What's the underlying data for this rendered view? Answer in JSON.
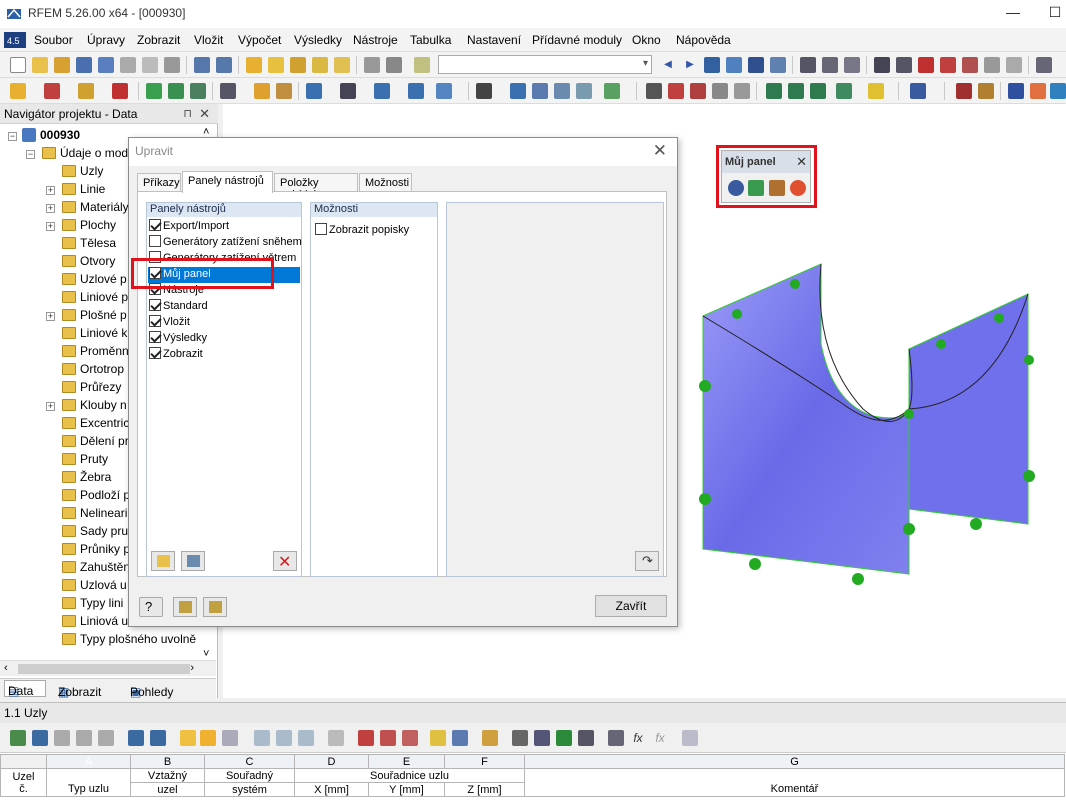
{
  "app": {
    "title": "RFEM 5.26.00 x64 - [000930]"
  },
  "menu": [
    "Soubor",
    "Úpravy",
    "Zobrazit",
    "Vložit",
    "Výpočet",
    "Výsledky",
    "Nástroje",
    "Tabulka",
    "Nastavení",
    "Přídavné moduly",
    "Okno",
    "Nápověda"
  ],
  "navigator": {
    "title": "Navigátor projektu - Data",
    "root": "000930",
    "group": "Údaje o mod",
    "items": [
      "Uzly",
      "Linie",
      "Materiály",
      "Plochy",
      "Tělesa",
      "Otvory",
      "Uzlové p",
      "Liniové p",
      "Plošné p",
      "Liniové k",
      "Proměnn",
      "Ortotrop",
      "Průřezy",
      "Klouby n",
      "Excentric",
      "Dělení pr",
      "Pruty",
      "Žebra",
      "Podloží p",
      "Nelineari",
      "Sady pru",
      "Průniky p",
      "Zahuštěn",
      "Uzlová u",
      "Typy lini",
      "Liniová u",
      "Typy plošného uvolně"
    ],
    "tabs": [
      "Data",
      "Zobrazit",
      "Pohledy"
    ]
  },
  "dialog": {
    "title": "Upravit",
    "tabs": [
      "Příkazy",
      "Panely nástrojů",
      "Položky nabídek",
      "Možnosti"
    ],
    "active_tab": "Panely nástrojů",
    "toolbars_header": "Panely nástrojů",
    "toolbars": [
      {
        "label": "Export/Import",
        "checked": true
      },
      {
        "label": "Generátory zatížení sněhem",
        "checked": false
      },
      {
        "label": "Generátory zatížení větrem",
        "checked": false
      },
      {
        "label": "Můj panel",
        "checked": true,
        "selected": true
      },
      {
        "label": "Nástroje",
        "checked": true
      },
      {
        "label": "Standard",
        "checked": true
      },
      {
        "label": "Vložit",
        "checked": true
      },
      {
        "label": "Výsledky",
        "checked": true
      },
      {
        "label": "Zobrazit",
        "checked": true
      }
    ],
    "options_header": "Možnosti",
    "show_labels": "Zobrazit popisky",
    "close_label": "Zavřít"
  },
  "floating_panel": {
    "title": "Můj panel"
  },
  "table": {
    "title": "1.1 Uzly",
    "letters": [
      "A",
      "B",
      "C",
      "D",
      "E",
      "F",
      "G"
    ],
    "uzel": "Uzel",
    "uzel_c": "č.",
    "typ_uzlu": "Typ uzlu",
    "vztazny_1": "Vztažný",
    "vztazny_2": "uzel",
    "sour_sys_1": "Souřadný",
    "sour_sys_2": "systém",
    "coords": "Souřadnice uzlu",
    "x": "X [mm]",
    "y": "Y [mm]",
    "z": "Z [mm]",
    "comment": "Komentář"
  },
  "colors": {
    "accent": "#0078d7",
    "highlight": "#e0121b",
    "surface": "#7f7ff0",
    "support": "#22aa22"
  }
}
